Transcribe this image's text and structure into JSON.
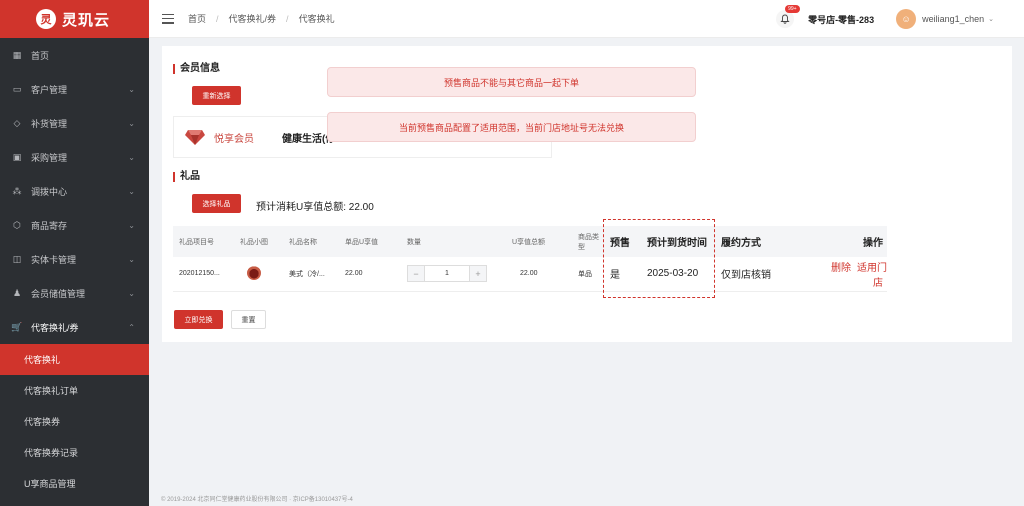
{
  "app": {
    "logo_glyph": "灵",
    "name": "灵玑云"
  },
  "sidebar": {
    "items": [
      {
        "label": "首页",
        "icon": "grid-icon"
      },
      {
        "label": "客户管理",
        "icon": "customer-icon"
      },
      {
        "label": "补货管理",
        "icon": "gem-icon"
      },
      {
        "label": "采购管理",
        "icon": "purchase-icon"
      },
      {
        "label": "调拨中心",
        "icon": "transfer-icon"
      },
      {
        "label": "商品寄存",
        "icon": "box-icon"
      },
      {
        "label": "实体卡管理",
        "icon": "book-icon"
      },
      {
        "label": "会员储值管理",
        "icon": "members-icon"
      },
      {
        "label": "代客换礼/券",
        "icon": "cart-icon"
      }
    ],
    "subitems": [
      {
        "label": "代客换礼"
      },
      {
        "label": "代客换礼订单"
      },
      {
        "label": "代客换券"
      },
      {
        "label": "代客换券记录"
      },
      {
        "label": "U享商品管理"
      }
    ]
  },
  "header": {
    "breadcrumb": [
      "首页",
      "代客换礼/券",
      "代客换礼"
    ],
    "notification_badge": "99+",
    "store": "零号店-零售-283",
    "user": "weiliang1_chen"
  },
  "member_section": {
    "title": "会员信息",
    "reselect_label": "重新选择",
    "level": "悦享会员",
    "name": "健康生活(停..."
  },
  "gift_section": {
    "title": "礼品",
    "select_label": "选择礼品",
    "total_label": "预计消耗U享值总额: 22.00"
  },
  "table": {
    "headers": [
      "礼品项目号",
      "礼品小图",
      "礼品名称",
      "单品U享值",
      "数量",
      "U享值总额",
      "商品类型",
      "预售",
      "预计到货时间",
      "履约方式",
      "操作"
    ],
    "row": {
      "item_no": "202012150...",
      "name": "美式（冷/...",
      "unit_value": "22.00",
      "quantity": "1",
      "total_value": "22.00",
      "type": "单品",
      "presale": "是",
      "arrival": "2025-03-20",
      "fulfillment": "仅到店核销",
      "op_delete": "删除",
      "op_stores": "适用门店"
    }
  },
  "actions": {
    "redeem_label": "立即兑换",
    "reset_label": "重置"
  },
  "toasts": [
    "预售商品不能与其它商品一起下单",
    "当前预售商品配置了适用范围，当前门店地址号无法兑换"
  ],
  "footer": "© 2019-2024 北京同仁堂健康药业股份有限公司 · 京ICP备13010437号-4",
  "colors": {
    "brand_red": "#d0342c",
    "sidebar_bg": "#2c2f33"
  }
}
